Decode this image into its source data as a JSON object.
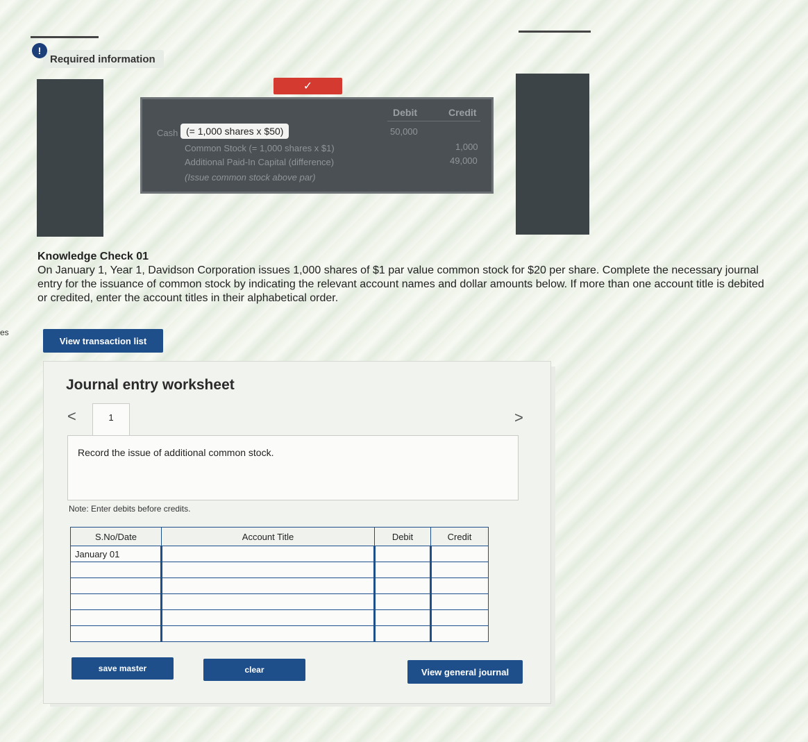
{
  "header": {
    "required_label": "Required information",
    "info_icon": "!",
    "check_glyph": "✓"
  },
  "reference_panel": {
    "debit_header": "Debit",
    "credit_header": "Credit",
    "cash_label": "Cash",
    "cash_tooltip": "(= 1,000 shares  x  $50)",
    "cash_debit": "50,000",
    "rows": [
      {
        "label": "Common Stock (= 1,000 shares  x  $1)",
        "credit": "1,000"
      },
      {
        "label": "Additional Paid-In Capital (difference)",
        "credit": "49,000"
      },
      {
        "label": "(Issue common stock above par)",
        "credit": ""
      }
    ]
  },
  "knowledge_check": {
    "title": "Knowledge Check 01",
    "body": "On January 1, Year 1, Davidson Corporation issues 1,000 shares of $1 par value common stock for $20 per share. Complete the necessary journal entry for the issuance of common stock by indicating the relevant account names and dollar amounts below. If more than one account title is debited or credited, enter the account titles in their alphabetical order."
  },
  "side_fragment": "es",
  "buttons": {
    "view_transaction_list": "View transaction list",
    "save_master": "save master",
    "clear": "clear",
    "view_general_journal": "View general journal"
  },
  "worksheet": {
    "title": "Journal entry worksheet",
    "tab_number": "1",
    "prev_glyph": "<",
    "next_glyph": ">",
    "description": "Record the issue of additional common stock.",
    "note": "Note: Enter debits before credits.",
    "columns": [
      "S.No/Date",
      "Account Title",
      "Debit",
      "Credit"
    ],
    "rows": [
      {
        "date": "January 01",
        "account": "",
        "debit": "",
        "credit": ""
      },
      {
        "date": "",
        "account": "",
        "debit": "",
        "credit": ""
      },
      {
        "date": "",
        "account": "",
        "debit": "",
        "credit": ""
      },
      {
        "date": "",
        "account": "",
        "debit": "",
        "credit": ""
      },
      {
        "date": "",
        "account": "",
        "debit": "",
        "credit": ""
      },
      {
        "date": "",
        "account": "",
        "debit": "",
        "credit": ""
      }
    ]
  },
  "colors": {
    "primary_blue": "#1e4f8b",
    "alert_red": "#d43a30",
    "dark_panel": "#4a5054"
  }
}
